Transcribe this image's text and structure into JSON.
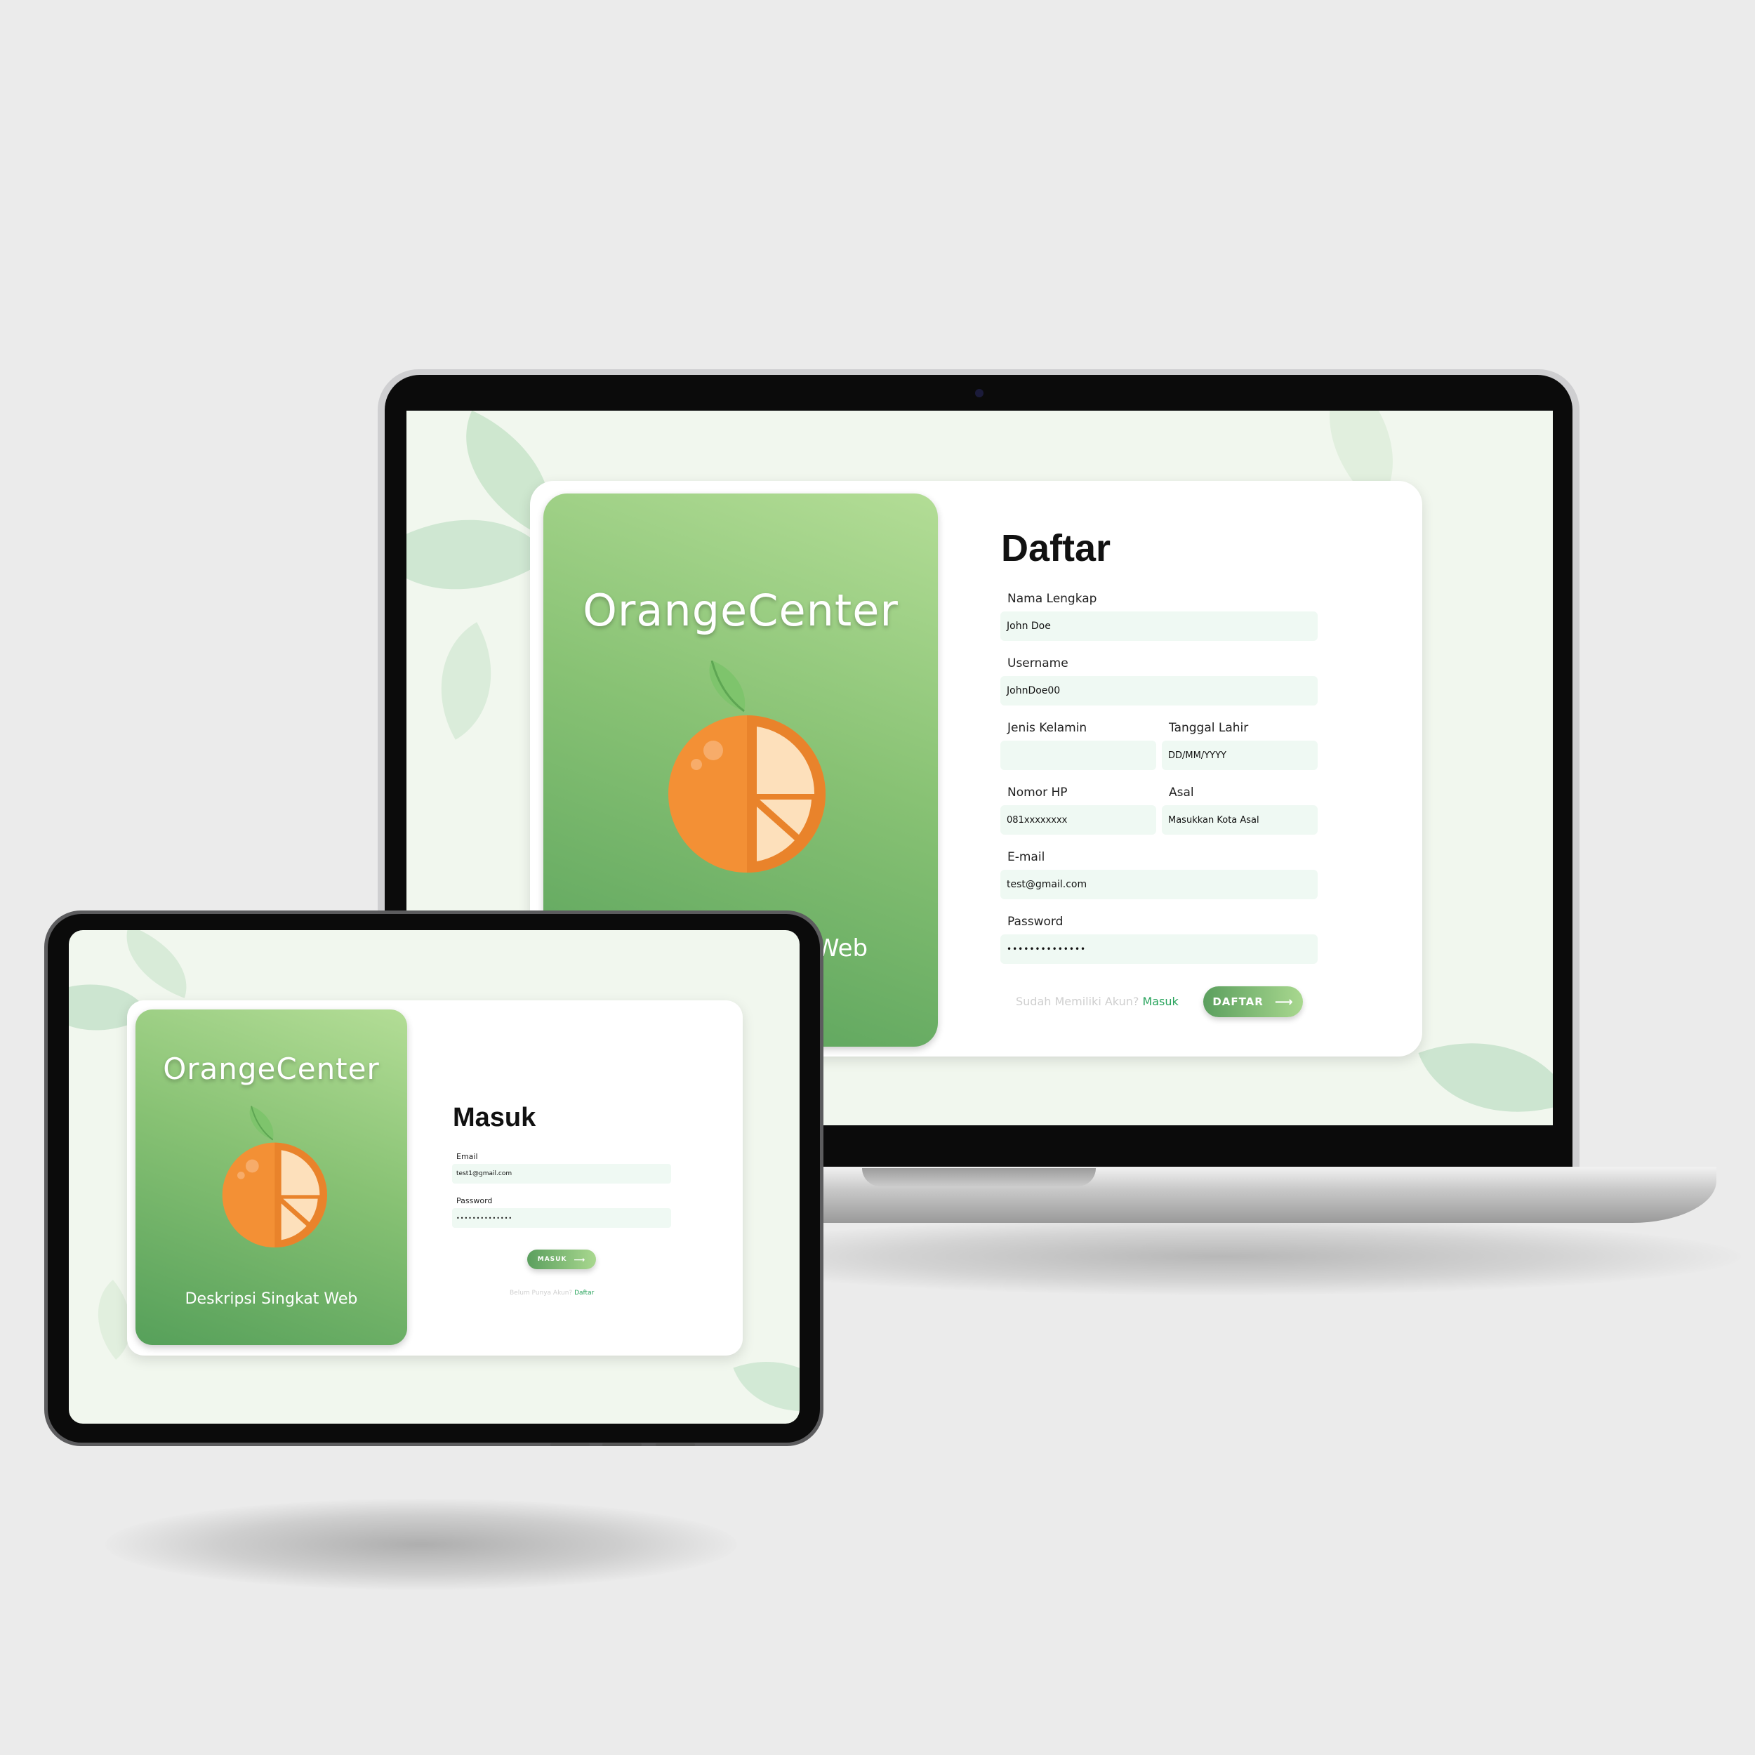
{
  "colors": {
    "background": "#ebebeb",
    "brand_gradient_light": "#b3dd96",
    "brand_gradient_dark": "#56a05a",
    "field_bg": "#eff9f3",
    "link": "#27a35b",
    "orange": "#f39035",
    "orange_slice": "#fde0bb"
  },
  "laptop": {
    "brand": {
      "title": "OrangeCenter",
      "description": "Deskripsi Singkat Web",
      "visible_description_fragment": "Web",
      "icon": "orange-fruit-icon"
    },
    "register_form": {
      "title": "Daftar",
      "fields": {
        "full_name": {
          "label": "Nama Lengkap",
          "value": "John Doe"
        },
        "username": {
          "label": "Username",
          "value": "JohnDoe00"
        },
        "gender": {
          "label": "Jenis Kelamin",
          "value": ""
        },
        "birth_date": {
          "label": "Tanggal Lahir",
          "value": "DD/MM/YYYY"
        },
        "phone": {
          "label": "Nomor HP",
          "value": "081xxxxxxxx"
        },
        "origin": {
          "label": "Asal",
          "value": "Masukkan Kota Asal"
        },
        "email": {
          "label": "E-mail",
          "value": "test@gmail.com"
        },
        "password": {
          "label": "Password",
          "value": "••••••••••••••"
        }
      },
      "footer_text": "Sudah Memiliki Akun?",
      "footer_link": "Masuk",
      "submit_label": "DAFTAR",
      "submit_icon": "arrow-right-icon"
    }
  },
  "tablet": {
    "brand": {
      "title": "OrangeCenter",
      "description": "Deskripsi Singkat Web",
      "icon": "orange-fruit-icon"
    },
    "login_form": {
      "title": "Masuk",
      "fields": {
        "email": {
          "label": "Email",
          "value": "test1@gmail.com"
        },
        "password": {
          "label": "Password",
          "value": "••••••••••••••"
        }
      },
      "submit_label": "MASUK",
      "submit_icon": "arrow-right-icon",
      "footer_text": "Belum Punya Akun?",
      "footer_link": "Daftar"
    }
  }
}
